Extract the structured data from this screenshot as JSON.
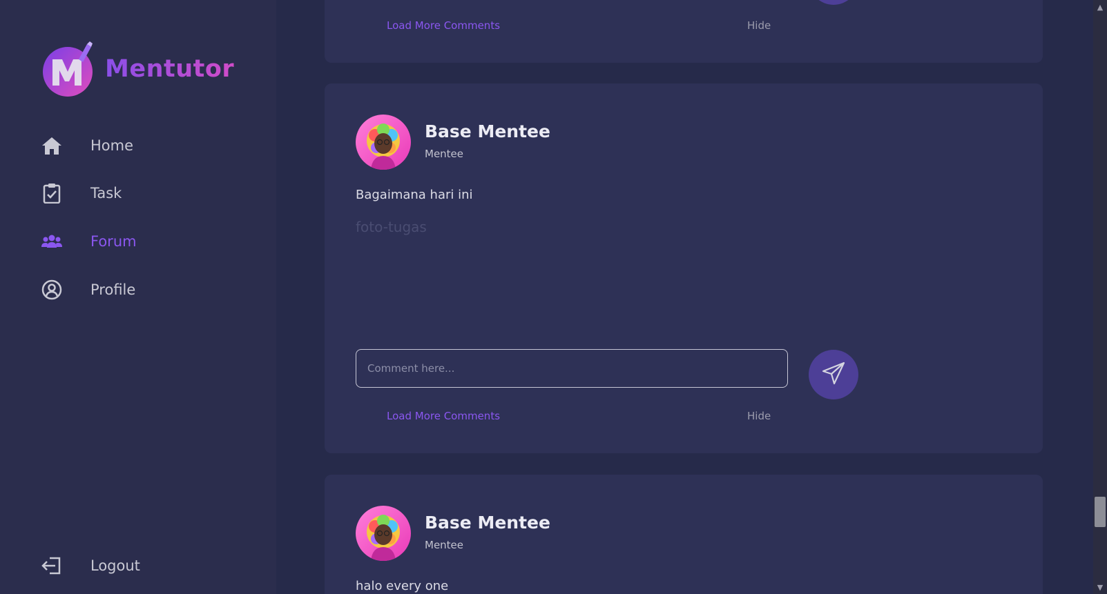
{
  "app": {
    "name": "Mentutor",
    "brand_color": "#8b57f0"
  },
  "sidebar": {
    "items": [
      {
        "label": "Home",
        "icon": "home-icon",
        "active": false
      },
      {
        "label": "Task",
        "icon": "task-clipboard-icon",
        "active": false
      },
      {
        "label": "Forum",
        "icon": "users-group-icon",
        "active": true
      },
      {
        "label": "Profile",
        "icon": "user-circle-icon",
        "active": false
      }
    ],
    "logout": {
      "label": "Logout",
      "icon": "logout-icon"
    }
  },
  "posts": [
    {
      "load_more_label": "Load More Comments",
      "hide_label": "Hide"
    },
    {
      "author": {
        "name": "Base Mentee",
        "role": "Mentee"
      },
      "text": "Bagaimana hari ini",
      "image_alt": "foto-tugas",
      "comment_placeholder": "Comment here...",
      "load_more_label": "Load More Comments",
      "hide_label": "Hide"
    },
    {
      "author": {
        "name": "Base Mentee",
        "role": "Mentee"
      },
      "text": "halo every one"
    }
  ]
}
